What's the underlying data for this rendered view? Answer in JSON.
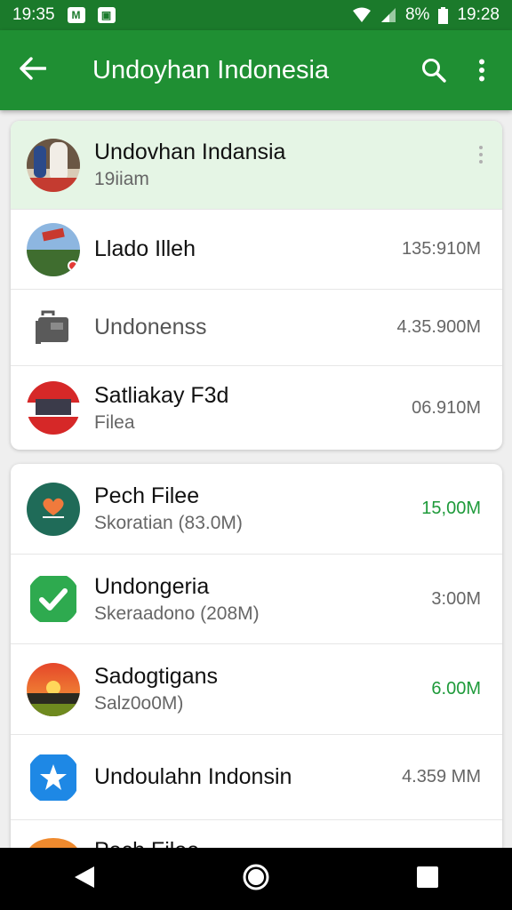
{
  "status_bar": {
    "time_left": "19:35",
    "battery": "8%",
    "time_right": "19:28"
  },
  "appbar": {
    "title": "Undoyhan Indonesia"
  },
  "card1": [
    {
      "name": "Undovhan Indansia",
      "sub": "19iiam",
      "size": ""
    },
    {
      "name": "Llado Illeh",
      "sub": "",
      "size": "135:910M"
    },
    {
      "name": "Undonenss",
      "sub": "",
      "size": "4.35.900M"
    },
    {
      "name": "Satliakay F3d",
      "sub": "Filea",
      "size": "06.910M"
    }
  ],
  "card2": [
    {
      "name": "Pech Filee",
      "sub": "Skoratian  (83.0M)",
      "size": "15,00M"
    },
    {
      "name": "Undongeria",
      "sub": "Skeraadono (208M)",
      "size": "3:00M"
    },
    {
      "name": "Sadogtigans",
      "sub": "Salz0o0M)",
      "size": "6.00M"
    },
    {
      "name": "Undoulahn Indonsin",
      "sub": "",
      "size": "4.359 MM"
    },
    {
      "name": "Pech Filee",
      "sub": "",
      "size": ""
    }
  ],
  "colors": {
    "status": "#1b7a2b",
    "appbar": "#1f8f33",
    "highlight": "#e5f5e5",
    "size_green": "#1e9a3a"
  }
}
